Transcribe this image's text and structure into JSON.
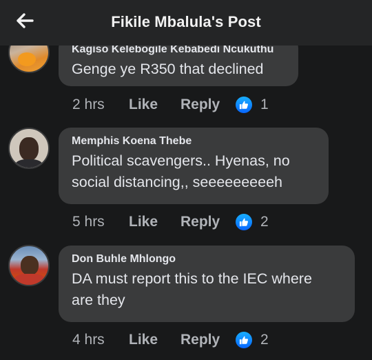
{
  "header": {
    "title": "Fikile Mbalula's Post",
    "back_icon": "arrow-left-icon"
  },
  "comments": [
    {
      "author": "Kagiso Kelebogile Kebabedi Ncukuthu",
      "lines": [
        "Genge ye R350 that declined"
      ],
      "time": "2 hrs",
      "like_label": "Like",
      "reply_label": "Reply",
      "reaction_icon": "thumbs-up-icon",
      "reaction_count": "1"
    },
    {
      "author": "Memphis Koena Thebe",
      "lines": [
        "Political scavengers.. Hyenas, no",
        "social distancing,, seeeeeeeeeh"
      ],
      "time": "5 hrs",
      "like_label": "Like",
      "reply_label": "Reply",
      "reaction_icon": "thumbs-up-icon",
      "reaction_count": "2"
    },
    {
      "author": "Don Buhle Mhlongo",
      "lines": [
        "DA must report this to the IEC where",
        "are they"
      ],
      "time": "4 hrs",
      "like_label": "Like",
      "reply_label": "Reply",
      "reaction_icon": "thumbs-up-icon",
      "reaction_count": "2"
    }
  ],
  "colors": {
    "background": "#18191a",
    "header": "#242526",
    "bubble": "#3a3b3c",
    "text": "#e4e6eb",
    "secondary_text": "#b0b3b8",
    "like_blue": "#0866ff"
  }
}
